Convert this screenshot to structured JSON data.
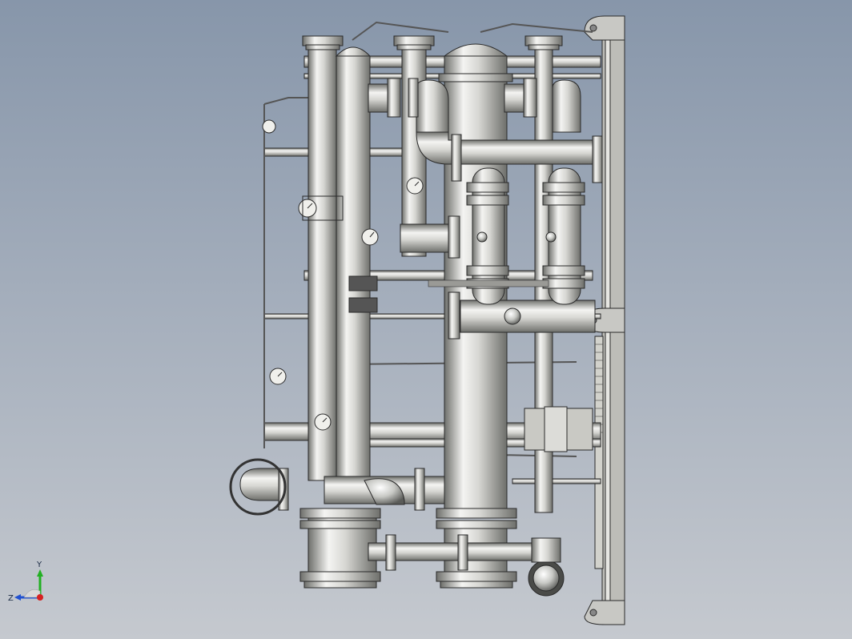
{
  "viewport": {
    "background_top": "#8796aa",
    "background_bottom": "#c5c9cf",
    "model_name": "",
    "metal_light": "#f4f4f2",
    "metal_mid": "#b9bab6",
    "metal_dark": "#6e6f6b",
    "outline": "#2a2a2a"
  },
  "triad": {
    "x_label": "",
    "y_label": "Y",
    "z_label": "Z",
    "x_color": "#d62020",
    "y_color": "#22b022",
    "z_color": "#2050d0",
    "x_icon": "x-axis-icon",
    "y_icon": "y-axis-icon",
    "z_icon": "z-axis-icon"
  }
}
